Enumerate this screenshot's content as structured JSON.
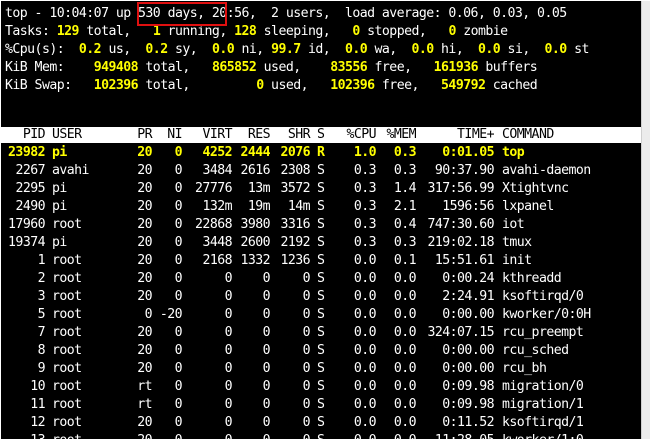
{
  "summary": {
    "line1": {
      "prefix": "top - 10:04:07 up ",
      "uptime": "530 days,",
      "suffix": " 20:56,  2 users,  load average: 0.06, 0.03, 0.05"
    },
    "tasks": {
      "label": "Tasks:",
      "total": "129",
      "total_label": " total,",
      "running": "1",
      "running_label": " running,",
      "sleeping": "128",
      "sleeping_label": " sleeping,",
      "stopped": "0",
      "stopped_label": " stopped,",
      "zombie": "0",
      "zombie_label": " zombie"
    },
    "cpu": {
      "label": "%Cpu(s):",
      "us": "0.2",
      "us_label": " us,",
      "sy": "0.2",
      "sy_label": " sy,",
      "ni": "0.0",
      "ni_label": " ni,",
      "id": "99.7",
      "id_label": " id,",
      "wa": "0.0",
      "wa_label": " wa,",
      "hi": "0.0",
      "hi_label": " hi,",
      "si": "0.0",
      "si_label": " si,",
      "st": "0.0",
      "st_label": " st"
    },
    "mem": {
      "label": "KiB Mem:",
      "total": "949408",
      "total_label": " total,",
      "used": "865852",
      "used_label": " used,",
      "free": "83556",
      "free_label": " free,",
      "buffers": "161936",
      "buffers_label": " buffers"
    },
    "swap": {
      "label": "KiB Swap:",
      "total": "102396",
      "total_label": " total,",
      "used": "0",
      "used_label": " used,",
      "free": "102396",
      "free_label": " free,",
      "cached": "549792",
      "cached_label": " cached"
    }
  },
  "columns": [
    "PID",
    "USER",
    "PR",
    "NI",
    "VIRT",
    "RES",
    "SHR",
    "S",
    "%CPU",
    "%MEM",
    "TIME+",
    "COMMAND"
  ],
  "processes": [
    [
      "23982",
      "pi",
      "20",
      "0",
      "4252",
      "2444",
      "2076",
      "R",
      "1.0",
      "0.3",
      "0:01.05",
      "top"
    ],
    [
      "2267",
      "avahi",
      "20",
      "0",
      "3484",
      "2616",
      "2308",
      "S",
      "0.3",
      "0.3",
      "90:37.90",
      "avahi-daemon"
    ],
    [
      "2295",
      "pi",
      "20",
      "0",
      "27776",
      "13m",
      "3572",
      "S",
      "0.3",
      "1.4",
      "317:56.99",
      "Xtightvnc"
    ],
    [
      "2490",
      "pi",
      "20",
      "0",
      "132m",
      "19m",
      "14m",
      "S",
      "0.3",
      "2.1",
      "1596:56",
      "lxpanel"
    ],
    [
      "17960",
      "root",
      "20",
      "0",
      "22868",
      "3980",
      "3316",
      "S",
      "0.3",
      "0.4",
      "747:30.60",
      "iot"
    ],
    [
      "19374",
      "pi",
      "20",
      "0",
      "3448",
      "2600",
      "2192",
      "S",
      "0.3",
      "0.3",
      "219:02.18",
      "tmux"
    ],
    [
      "1",
      "root",
      "20",
      "0",
      "2168",
      "1332",
      "1236",
      "S",
      "0.0",
      "0.1",
      "15:51.61",
      "init"
    ],
    [
      "2",
      "root",
      "20",
      "0",
      "0",
      "0",
      "0",
      "S",
      "0.0",
      "0.0",
      "0:00.24",
      "kthreadd"
    ],
    [
      "3",
      "root",
      "20",
      "0",
      "0",
      "0",
      "0",
      "S",
      "0.0",
      "0.0",
      "2:24.91",
      "ksoftirqd/0"
    ],
    [
      "5",
      "root",
      "0",
      "-20",
      "0",
      "0",
      "0",
      "S",
      "0.0",
      "0.0",
      "0:00.00",
      "kworker/0:0H"
    ],
    [
      "7",
      "root",
      "20",
      "0",
      "0",
      "0",
      "0",
      "S",
      "0.0",
      "0.0",
      "324:07.15",
      "rcu_preempt"
    ],
    [
      "8",
      "root",
      "20",
      "0",
      "0",
      "0",
      "0",
      "S",
      "0.0",
      "0.0",
      "0:00.00",
      "rcu_sched"
    ],
    [
      "9",
      "root",
      "20",
      "0",
      "0",
      "0",
      "0",
      "S",
      "0.0",
      "0.0",
      "0:00.00",
      "rcu_bh"
    ],
    [
      "10",
      "root",
      "rt",
      "0",
      "0",
      "0",
      "0",
      "S",
      "0.0",
      "0.0",
      "0:09.98",
      "migration/0"
    ],
    [
      "11",
      "root",
      "rt",
      "0",
      "0",
      "0",
      "0",
      "S",
      "0.0",
      "0.0",
      "0:09.98",
      "migration/1"
    ],
    [
      "12",
      "root",
      "20",
      "0",
      "0",
      "0",
      "0",
      "S",
      "0.0",
      "0.0",
      "0:11.52",
      "ksoftirqd/1"
    ],
    [
      "13",
      "root",
      "20",
      "0",
      "0",
      "0",
      "0",
      "S",
      "0.0",
      "0.0",
      "11:28.05",
      "kworker/1:0"
    ]
  ],
  "annotation_color": "#e01010",
  "highlight_color": "#ffff00"
}
